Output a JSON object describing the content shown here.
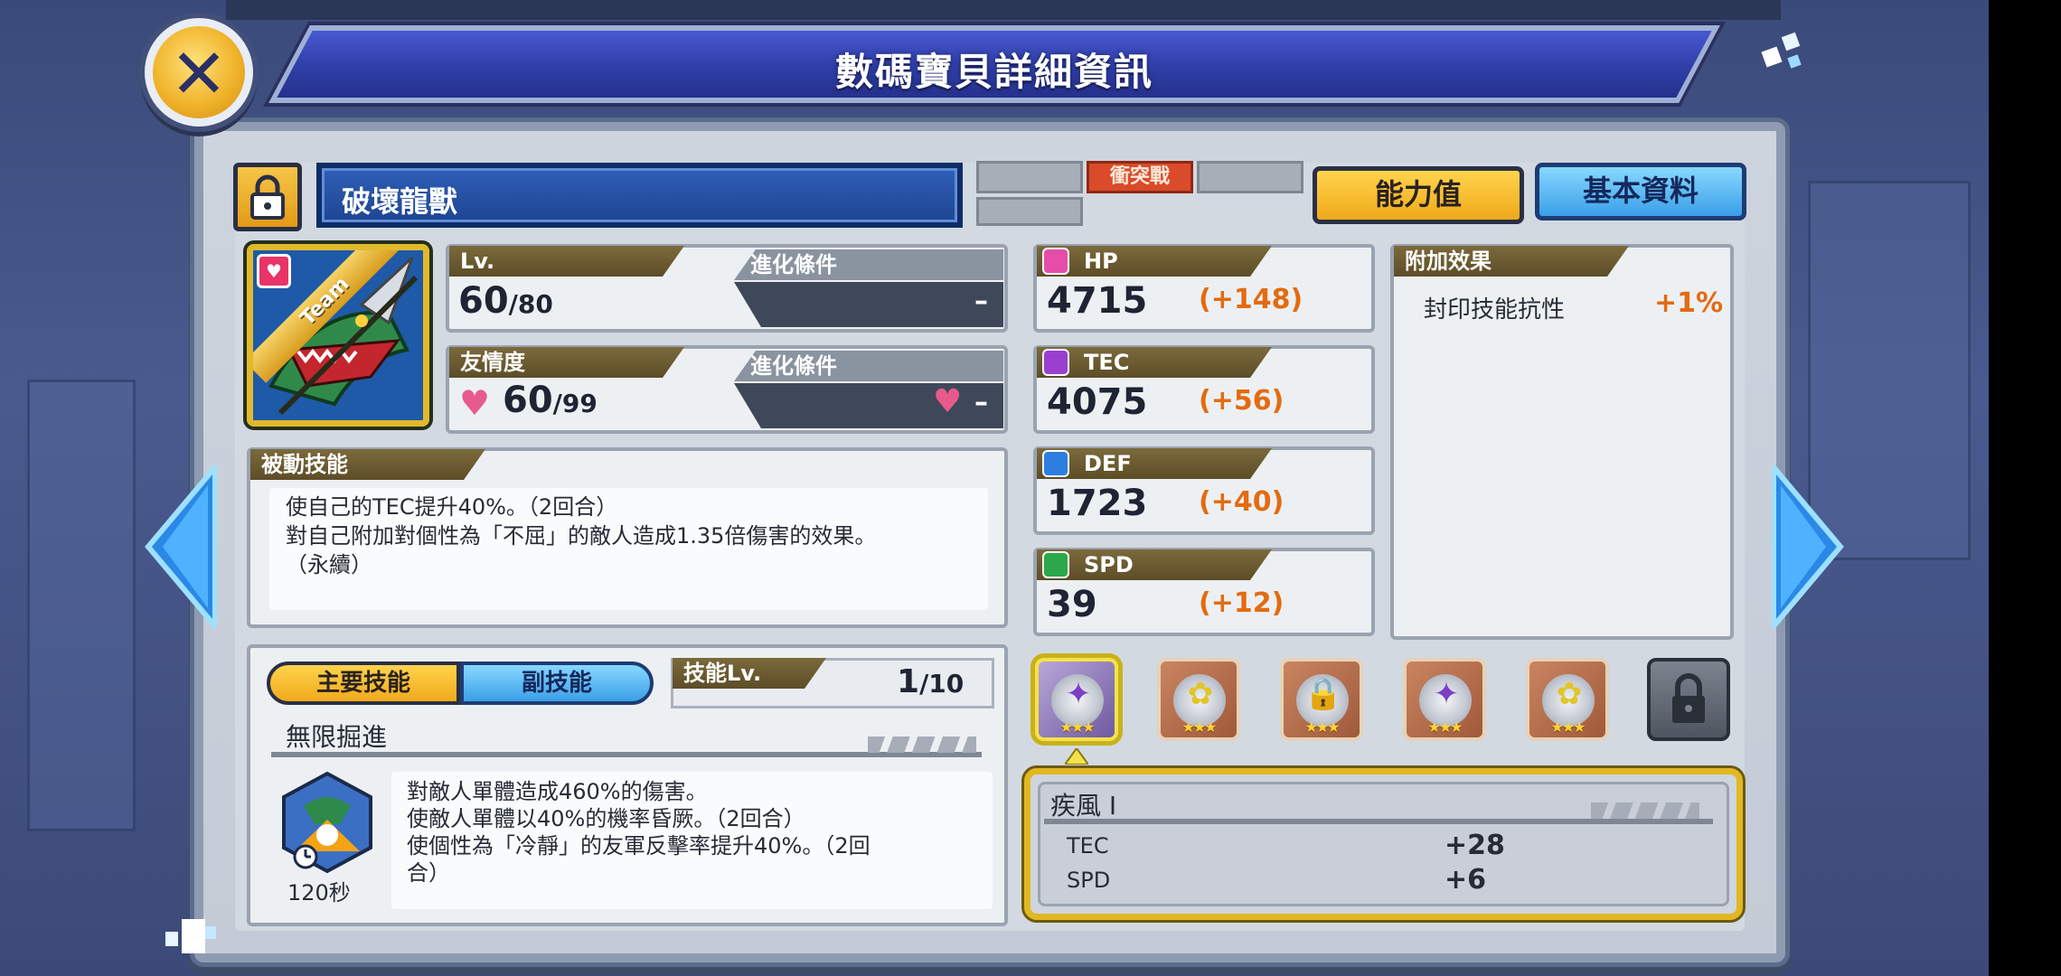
{
  "window": {
    "title": "數碼寶貝詳細資訊"
  },
  "header": {
    "name": "破壞龍獸",
    "clash_tag": "衝突戰"
  },
  "tabs": {
    "ability": "能力值",
    "basic": "基本資料"
  },
  "portrait": {
    "ribbon": "Team"
  },
  "level": {
    "label": "Lv.",
    "current": "60",
    "max": "/80",
    "evo_label": "進化條件",
    "evo_value": "–"
  },
  "friendship": {
    "label": "友情度",
    "current": "60",
    "max": "/99",
    "evo_label": "進化條件",
    "evo_value": "–"
  },
  "passive": {
    "label": "被動技能",
    "lines": [
      "使自己的TEC提升40%。（2回合）",
      "對自己附加對個性為「不屈」的敵人造成1.35倍傷害的效果。",
      "（永續）"
    ]
  },
  "stats": [
    {
      "name": "HP",
      "value": "4715",
      "bonus": "(+148)",
      "color": "#e64da8"
    },
    {
      "name": "TEC",
      "value": "4075",
      "bonus": "(+56)",
      "color": "#9b3fd1"
    },
    {
      "name": "DEF",
      "value": "1723",
      "bonus": "(+40)",
      "color": "#2c7ee0"
    },
    {
      "name": "SPD",
      "value": "39",
      "bonus": "(+12)",
      "color": "#2aa84a"
    }
  ],
  "extra_effect": {
    "label": "附加效果",
    "name": "封印技能抗性",
    "value": "+1%"
  },
  "skills": {
    "main_tab": "主要技能",
    "sub_tab": "副技能",
    "level_label": "技能Lv.",
    "level_value": "1",
    "level_max": "/10",
    "name": "無限掘進",
    "cooldown": "120秒",
    "lines": [
      "對敵人單體造成460%的傷害。",
      "使敵人單體以40%的機率昏厥。（2回合）",
      "使個性為「冷靜」的友軍反擊率提升40%。（2回",
      "合）"
    ]
  },
  "plugin": {
    "name": "疾風 I",
    "rows": [
      {
        "stat": "TEC",
        "value": "+28"
      },
      {
        "stat": "SPD",
        "value": "+6"
      }
    ]
  }
}
